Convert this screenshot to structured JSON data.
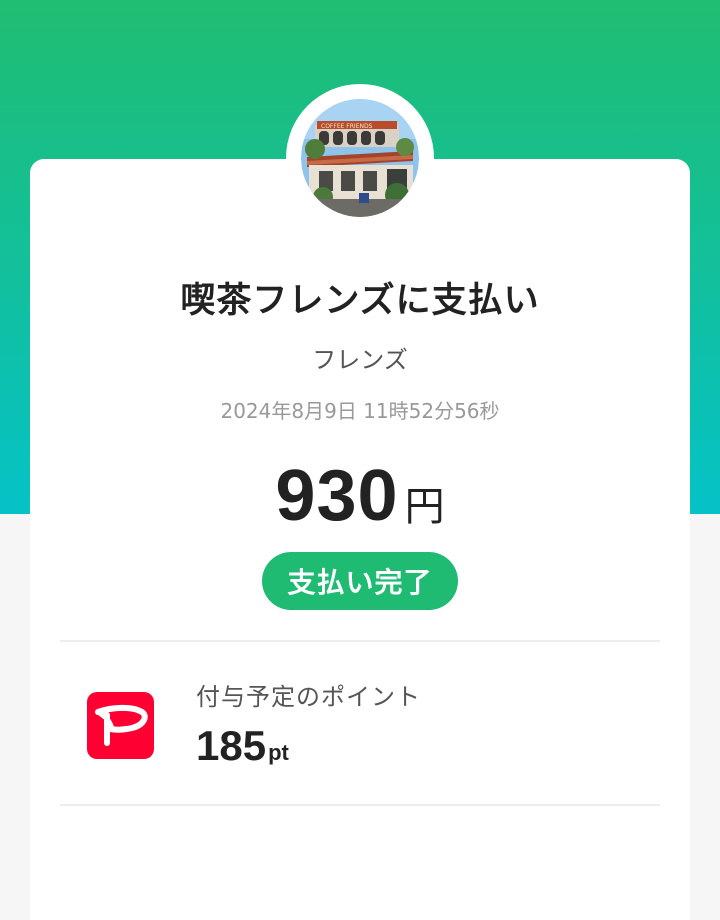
{
  "payment": {
    "title": "喫茶フレンズに支払い",
    "merchant_name": "フレンズ",
    "datetime": "2024年8月9日 11時52分56秒",
    "amount": "930",
    "currency_unit": "円",
    "status": "支払い完了"
  },
  "points": {
    "label": "付与予定のポイント",
    "value": "185",
    "unit": "pt",
    "logo": "paypay-logo-icon"
  },
  "colors": {
    "header_gradient_top": "#20bd72",
    "header_gradient_bottom": "#05c2c7",
    "status_badge": "#20bb72",
    "paypay_red": "#ff0033"
  }
}
